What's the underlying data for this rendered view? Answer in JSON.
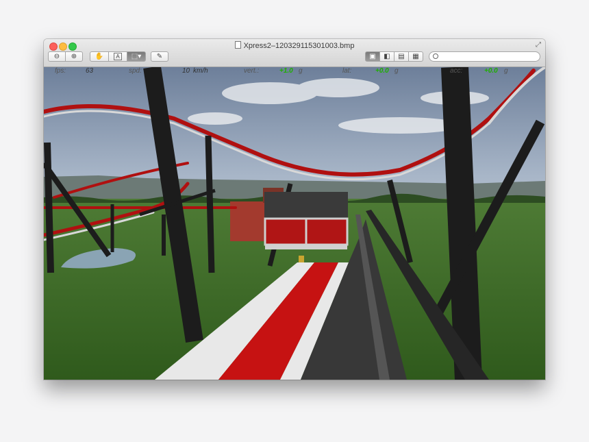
{
  "window": {
    "title": "Xpress2–120329115301003.bmp",
    "search_placeholder": ""
  },
  "toolbar": {
    "zoom_out_icon": "magnifier-minus-icon",
    "zoom_in_icon": "magnifier-plus-icon",
    "hand_icon": "hand-icon",
    "text_select_label": "A",
    "rect_select_icon": "selection-rect-icon",
    "annotate_icon": "pencil-icon",
    "view_modes": [
      "single-page-icon",
      "sidebar-icon",
      "two-page-icon",
      "contact-sheet-icon"
    ]
  },
  "hud": {
    "fps_label": "fps:",
    "fps_value": "63",
    "spd_label": "spd:",
    "spd_value": "10",
    "spd_unit": "km/h",
    "vert_label": "vert.:",
    "vert_value": "+1.0",
    "vert_unit": "g",
    "lat_label": "lat:",
    "lat_value": "+0.0",
    "lat_unit": "g",
    "acc_label": "acc:",
    "acc_value": "+0.0",
    "acc_unit": "g"
  },
  "colors": {
    "sky_top": "#6d7f9a",
    "track_red": "#b01010",
    "support_black": "#1a1a1a",
    "grass": "#3d6a28",
    "hud_green": "#1fb000"
  }
}
